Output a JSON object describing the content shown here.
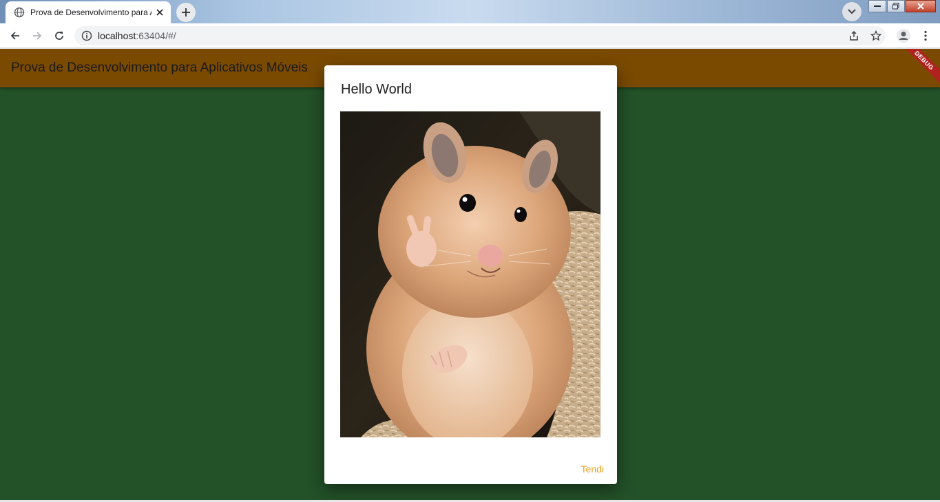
{
  "browser": {
    "tab_title": "Prova de Desenvolvimento para Aplicativos Móveis",
    "tab_close_icon": "close-icon",
    "url_host": "localhost",
    "url_rest": ":63404/#/"
  },
  "app": {
    "appbar_title": "Prova de Desenvolvimento para Aplicativos Móveis",
    "debug_banner": "DEBUG",
    "background_color": "#235128",
    "appbar_color": "#7a4a00"
  },
  "dialog": {
    "title": "Hello World",
    "image_subject": "hamster-photo",
    "action_label": "Tendi",
    "action_color": "#f0a21a"
  }
}
